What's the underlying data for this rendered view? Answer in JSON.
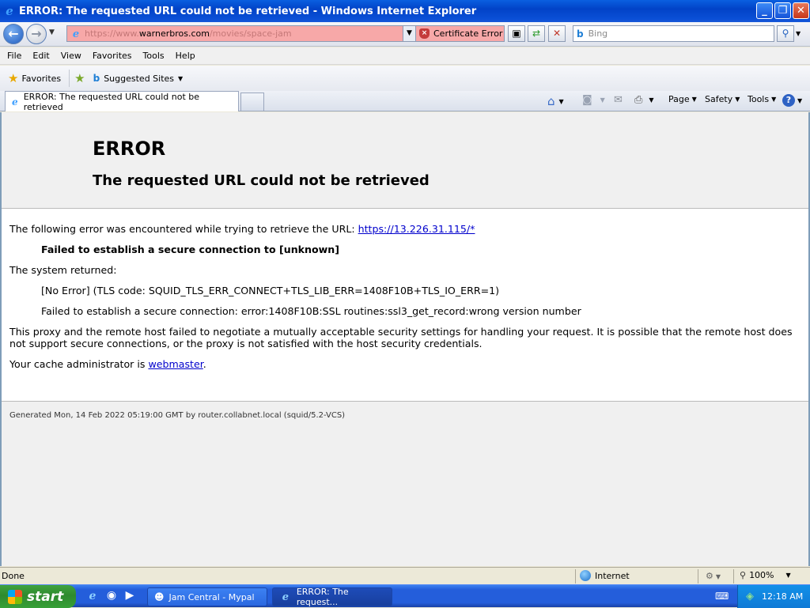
{
  "window": {
    "title": "ERROR: The requested URL could not be retrieved - Windows Internet Explorer",
    "minimize_glyph": "_",
    "maximize_glyph": "❐",
    "close_glyph": "✕"
  },
  "address_bar": {
    "url_prefix": "https://www.",
    "url_domain": "warnerbros.com",
    "url_path": "/movies/space-jam",
    "cert_error_label": "Certificate Error",
    "search_placeholder": "Bing"
  },
  "menu": {
    "items": [
      "File",
      "Edit",
      "View",
      "Favorites",
      "Tools",
      "Help"
    ]
  },
  "favorites_bar": {
    "favorites_label": "Favorites",
    "suggested_sites_label": "Suggested Sites"
  },
  "tabs": {
    "active_tab_title": "ERROR: The requested URL could not be retrieved"
  },
  "command_bar": {
    "page_label": "Page",
    "safety_label": "Safety",
    "tools_label": "Tools"
  },
  "page": {
    "heading": "ERROR",
    "subheading": "The requested URL could not be retrieved",
    "intro_text": "The following error was encountered while trying to retrieve the URL: ",
    "url_link": "https://13.226.31.115/*",
    "failure_message": "Failed to establish a secure connection to [unknown]",
    "system_returned_label": "The system returned:",
    "tls_code": "[No Error] (TLS code: SQUID_TLS_ERR_CONNECT+TLS_LIB_ERR=1408F10B+TLS_IO_ERR=1)",
    "ssl_error": "Failed to establish a secure connection: error:1408F10B:SSL routines:ssl3_get_record:wrong version number",
    "explanation": "This proxy and the remote host failed to negotiate a mutually acceptable security settings for handling your request. It is possible that the remote host does not support secure connections, or the proxy is not satisfied with the host security credentials.",
    "admin_text": "Your cache administrator is ",
    "admin_link": "webmaster",
    "admin_period": ".",
    "generated": "Generated Mon, 14 Feb 2022 05:19:00 GMT by router.collabnet.local (squid/5.2-VCS)"
  },
  "status_bar": {
    "status": "Done",
    "zone": "Internet",
    "zoom": "100%"
  },
  "taskbar": {
    "start_label": "start",
    "task1_label": "Jam Central - Mypal",
    "task2_label": "ERROR: The request...",
    "clock": "12:18 AM"
  }
}
